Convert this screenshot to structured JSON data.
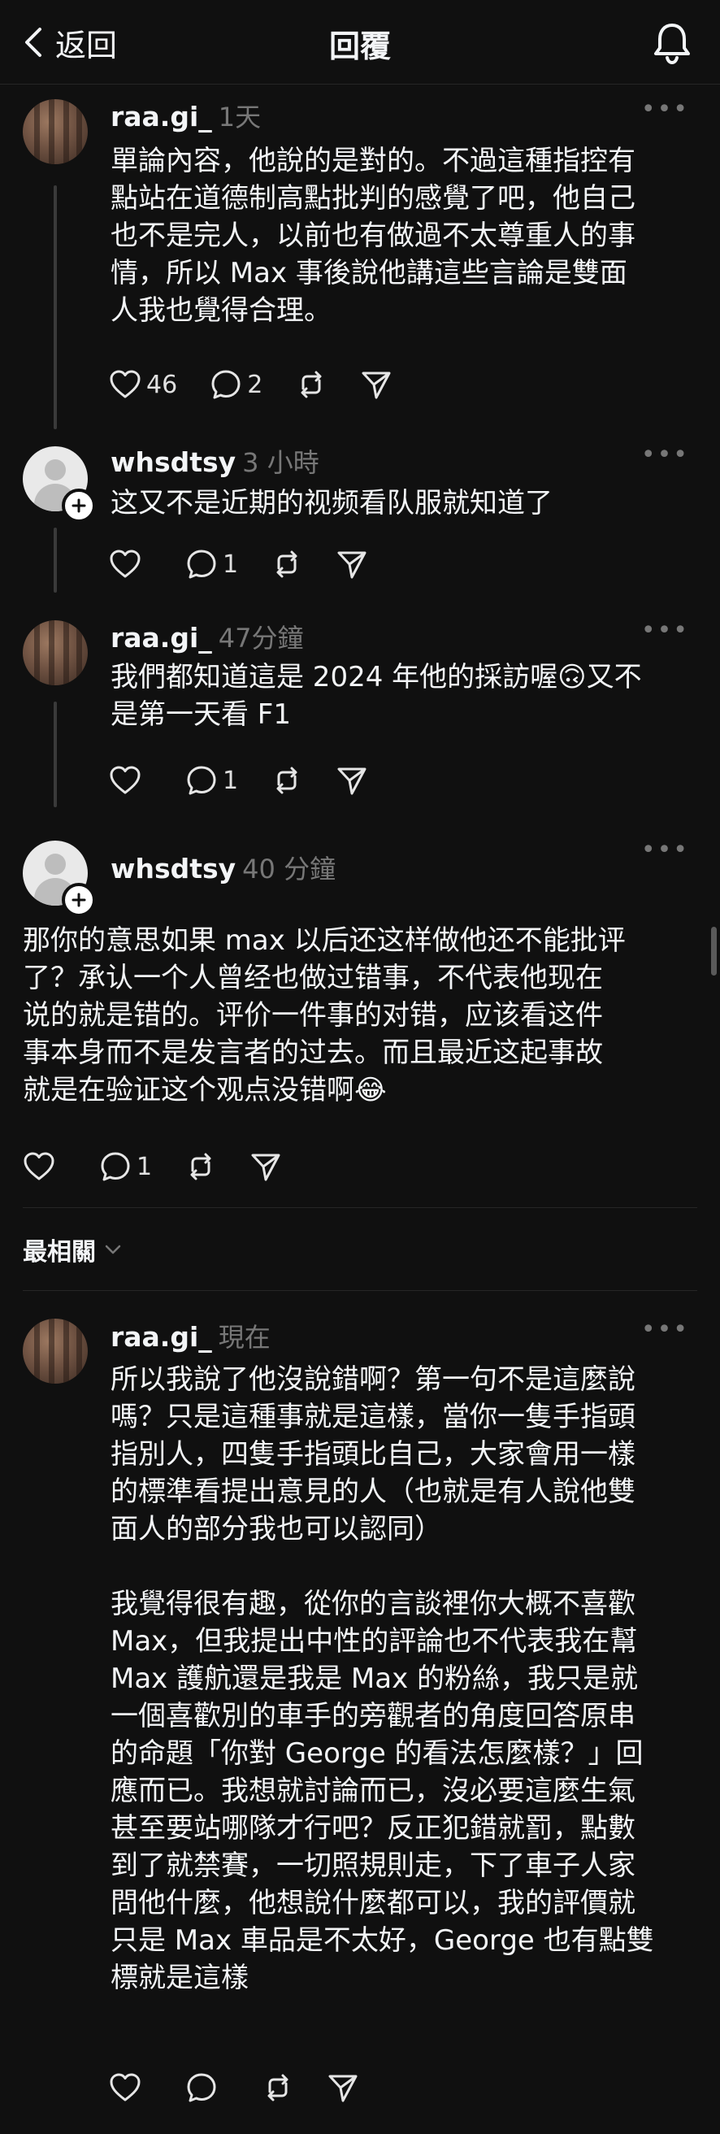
{
  "header": {
    "back_label": "返回",
    "title": "回覆"
  },
  "sort": {
    "label": "最相關"
  },
  "posts": [
    {
      "username": "raa.gi_",
      "time": "1天",
      "lines": [
        "單論內容，他說的是對的。不過這種指控有",
        "點站在道德制高點批判的感覺了吧，他自己",
        "也不是完人，以前也有做過不太尊重人的事",
        "情，所以 Max 事後說他講這些言論是雙面",
        "人我也覺得合理。"
      ],
      "likes": "46",
      "replies": "2"
    },
    {
      "username": "whsdtsy",
      "time": "3 小時",
      "lines": [
        "这又不是近期的视频看队服就知道了"
      ],
      "likes": "",
      "replies": "1"
    },
    {
      "username": "raa.gi_",
      "time": "47分鐘",
      "lines": [
        "我們都知道這是 2024 年他的採訪喔🙃又不",
        "是第一天看 F1"
      ],
      "likes": "",
      "replies": "1"
    },
    {
      "username": "whsdtsy",
      "time": "40 分鐘",
      "lines": [
        "那你的意思如果 max 以后还这样做他还不能批评",
        "了？承认一个人曾经也做过错事，不代表他现在",
        "说的就是错的。评价一件事的对错，应该看这件",
        "事本身而不是发言者的过去。而且最近这起事故",
        "就是在验证这个观点没错啊😂"
      ],
      "likes": "",
      "replies": "1"
    },
    {
      "username": "raa.gi_",
      "time": "現在",
      "para1": [
        "所以我說了他沒說錯啊？第一句不是這麼說",
        "嗎？只是這種事就是這樣，當你一隻手指頭",
        "指別人，四隻手指頭比自己，大家會用一樣",
        "的標準看提出意見的人（也就是有人說他雙",
        "面人的部分我也可以認同）"
      ],
      "para2": [
        "我覺得很有趣，從你的言談裡你大概不喜歡",
        "Max，但我提出中性的評論也不代表我在幫",
        "Max 護航還是我是 Max 的粉絲，我只是就",
        "一個喜歡別的車手的旁觀者的角度回答原串",
        "的命題「你對 George 的看法怎麼樣？」回",
        "應而已。我想就討論而已，沒必要這麼生氣",
        "甚至要站哪隊才行吧？反正犯錯就罰，點數",
        "到了就禁賽，一切照規則走，下了車子人家",
        "問他什麼，他想說什麼都可以，我的評價就",
        "只是 Max 車品是不太好，George 也有點雙",
        "標就是這樣"
      ],
      "likes": "",
      "replies": ""
    }
  ]
}
